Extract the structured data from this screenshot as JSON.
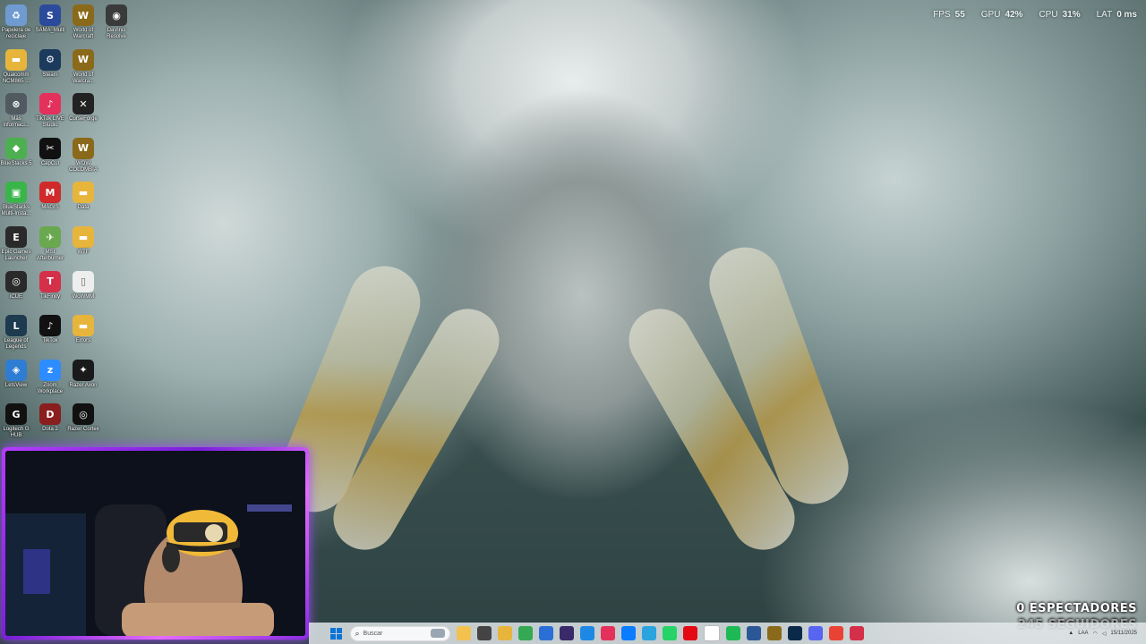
{
  "hud": {
    "fps_label": "FPS",
    "fps_value": "55",
    "gpu_label": "GPU",
    "gpu_value": "42%",
    "cpu_label": "CPU",
    "cpu_value": "31%",
    "lat_label": "LAT",
    "lat_value": "0 ms"
  },
  "desktop_icons": [
    {
      "name": "recycle-bin-icon",
      "label": "Papelera de reciclaje",
      "color": "#6f9bd1",
      "glyph": "♻"
    },
    {
      "name": "sama-multi-icon",
      "label": "SAMA_Multi",
      "color": "#2c4a9c",
      "glyph": "S"
    },
    {
      "name": "world-of-warcraft-icon",
      "label": "World of Warcraft",
      "color": "#8a6a1a",
      "glyph": "W"
    },
    {
      "name": "davinci-resolve-icon",
      "label": "DaVinci Resolve",
      "color": "#3a3a3a",
      "glyph": "◉"
    },
    {
      "name": "qualcomm-folder-icon",
      "label": "Qualcomm NCM865 ...",
      "color": "#e7b53c",
      "glyph": "▬"
    },
    {
      "name": "steam-icon",
      "label": "Steam",
      "color": "#1b3a5c",
      "glyph": "⚙"
    },
    {
      "name": "world-of-warcraft-2-icon",
      "label": "World of Warcra...",
      "color": "#8a6a1a",
      "glyph": "W"
    },
    {
      "name": "mas-informacion-icon",
      "label": "Más informaci...",
      "color": "#505a60",
      "glyph": "⊗"
    },
    {
      "name": "tiktok-live-studio-icon",
      "label": "TikTok LIVE Studio",
      "color": "#e4315c",
      "glyph": "♪"
    },
    {
      "name": "curseforge-icon",
      "label": "CurseForge",
      "color": "#222222",
      "glyph": "✕"
    },
    {
      "name": "bluestacks-icon",
      "label": "BlueStacks 5",
      "color": "#4caf50",
      "glyph": "◆"
    },
    {
      "name": "capcut-icon",
      "label": "CapCut",
      "color": "#111111",
      "glyph": "✂"
    },
    {
      "name": "wow-colombia-icon",
      "label": "WOW COLOMBIA",
      "color": "#8a6a1a",
      "glyph": "W"
    },
    {
      "name": "bluestacks-multi-icon",
      "label": "BlueStacks Multi-Insta...",
      "color": "#39b54a",
      "glyph": "▣"
    },
    {
      "name": "magis-icon",
      "label": "MAGIS",
      "color": "#d02a2a",
      "glyph": "M"
    },
    {
      "name": "data-folder-icon",
      "label": "Data",
      "color": "#e7b53c",
      "glyph": "▬"
    },
    {
      "name": "epic-games-icon",
      "label": "Epic Games Launcher",
      "color": "#2a2a2a",
      "glyph": "E"
    },
    {
      "name": "msi-afterburner-icon",
      "label": "MSI Afterburner",
      "color": "#6aa84f",
      "glyph": "✈"
    },
    {
      "name": "wtf-folder-icon",
      "label": "WTF",
      "color": "#e7b53c",
      "glyph": "▬"
    },
    {
      "name": "icue-icon",
      "label": "iCUE",
      "color": "#2a2a2a",
      "glyph": "◎"
    },
    {
      "name": "tikfinity-icon",
      "label": "TikFinity",
      "color": "#d4304a",
      "glyph": "T"
    },
    {
      "name": "wowmm-file-icon",
      "label": "WoWMM",
      "color": "#eeeeee",
      "glyph": "▯"
    },
    {
      "name": "league-of-legends-icon",
      "label": "League of Legends",
      "color": "#1d3a4f",
      "glyph": "L"
    },
    {
      "name": "tiktok-icon",
      "label": "TikTok",
      "color": "#111111",
      "glyph": "♪"
    },
    {
      "name": "errors-folder-icon",
      "label": "Errors",
      "color": "#e7b53c",
      "glyph": "▬"
    },
    {
      "name": "letsview-icon",
      "label": "LetsView",
      "color": "#2f7dd3",
      "glyph": "◈"
    },
    {
      "name": "zoom-icon",
      "label": "Zoom Workplace",
      "color": "#2d8cff",
      "glyph": "z"
    },
    {
      "name": "razer-axon-icon",
      "label": "Razer Axon",
      "color": "#1a1a1a",
      "glyph": "✦"
    },
    {
      "name": "logitech-g-hub-icon",
      "label": "Logitech G HUB",
      "color": "#111111",
      "glyph": "G"
    },
    {
      "name": "dota-2-icon",
      "label": "Dota 2",
      "color": "#8a1d1d",
      "glyph": "D"
    },
    {
      "name": "razer-cortex-icon",
      "label": "Razer Cortex",
      "color": "#111111",
      "glyph": "◎"
    }
  ],
  "stream": {
    "viewers": "0 ESPECTADORES",
    "followers": "245 SEGUIDORES"
  },
  "taskbar": {
    "search_placeholder": "Buscar",
    "apps": [
      {
        "name": "file-explorer-icon",
        "color": "#f2c14e"
      },
      {
        "name": "task-view-icon",
        "color": "#444444"
      },
      {
        "name": "folder-icon",
        "color": "#e7b53c"
      },
      {
        "name": "chrome-icon",
        "color": "#34a853"
      },
      {
        "name": "store-icon",
        "color": "#2b6fd6"
      },
      {
        "name": "obs-icon",
        "color": "#3a2a6a"
      },
      {
        "name": "phone-link-icon",
        "color": "#1e88e5"
      },
      {
        "name": "tiktok-taskbar-icon",
        "color": "#e4315c"
      },
      {
        "name": "messenger-icon",
        "color": "#0a7cff"
      },
      {
        "name": "telegram-icon",
        "color": "#2aa3df"
      },
      {
        "name": "whatsapp-icon",
        "color": "#25d366"
      },
      {
        "name": "netflix-icon",
        "color": "#e50914"
      },
      {
        "name": "notepad-icon",
        "color": "#ffffff"
      },
      {
        "name": "spotify-icon",
        "color": "#1db954"
      },
      {
        "name": "visual-studio-icon",
        "color": "#2b5797"
      },
      {
        "name": "wow-taskbar-icon",
        "color": "#8a6a1a"
      },
      {
        "name": "lightroom-icon",
        "color": "#0b2a4a"
      },
      {
        "name": "discord-icon",
        "color": "#5865f2"
      },
      {
        "name": "chrome-2-icon",
        "color": "#ea4335"
      },
      {
        "name": "tikfinity-taskbar-icon",
        "color": "#d4304a"
      }
    ],
    "tray_lang": "LAA",
    "tray_date": "15/11/2025"
  }
}
